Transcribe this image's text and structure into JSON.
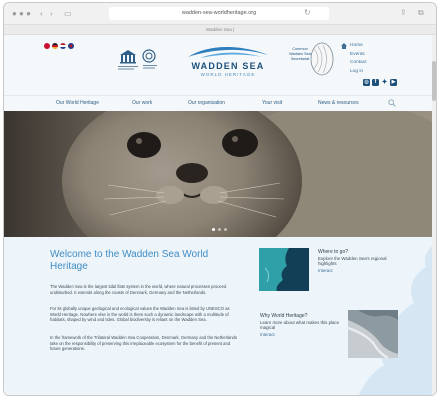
{
  "browser": {
    "url": "wadden-sea-worldheritage.org",
    "tab_title": "Wadden Sea |",
    "back_icon": "chevron-left-icon",
    "forward_icon": "chevron-right-icon"
  },
  "header": {
    "logo_title": "WADDEN SEA",
    "logo_subtitle": "WORLD HERITAGE",
    "secretariat_label": "Common Wadden Sea Secretariat",
    "flags": [
      "#b5282e",
      "#1f1f1f",
      "#d7a533",
      "#1b3f87"
    ],
    "top_links": [
      "Home",
      "Events",
      "Contact",
      "Log in"
    ],
    "social_icons": [
      "instagram-icon",
      "facebook-icon",
      "twitter-icon",
      "youtube-icon"
    ]
  },
  "nav": {
    "items": [
      "Our World Heritage",
      "Our work",
      "Our organisation",
      "Your visit",
      "News & resources"
    ]
  },
  "hero": {
    "slide_count": 3,
    "active_slide": 1
  },
  "main": {
    "welcome_title": "Welcome to the Wadden Sea World Heritage",
    "paragraphs": [
      "The Wadden Sea is the largest tidal flats system in the world, where natural processes proceed undisturbed. It extends along the coasts of Denmark, Germany and the Netherlands.",
      "For its globally unique geological and ecological values the Wadden Sea is listed by UNESCO as World Heritage. Nowhere else in the world is there such a dynamic landscape with a multitude of habitats, shaped by wind and tides. Global biodiversity is reliant on the Wadden Sea.",
      "In the framework of the Trilateral Wadden Sea Cooperation, Denmark, Germany and the Netherlands take on the responsibility of preserving this irreplaceable ecosystem for the benefit of present and future generations."
    ]
  },
  "cards": [
    {
      "title": "Where to go?",
      "text": "Explore the Wadden Sea's regional highlights",
      "link": "Interact"
    },
    {
      "title": "Why World Heritage?",
      "text": "Learn more about what makes this place magical",
      "link": "Interact"
    }
  ],
  "colors": {
    "accent": "#3f8cc4",
    "brand_dark": "#1d4f7a",
    "page_bg": "#eef5fa"
  }
}
